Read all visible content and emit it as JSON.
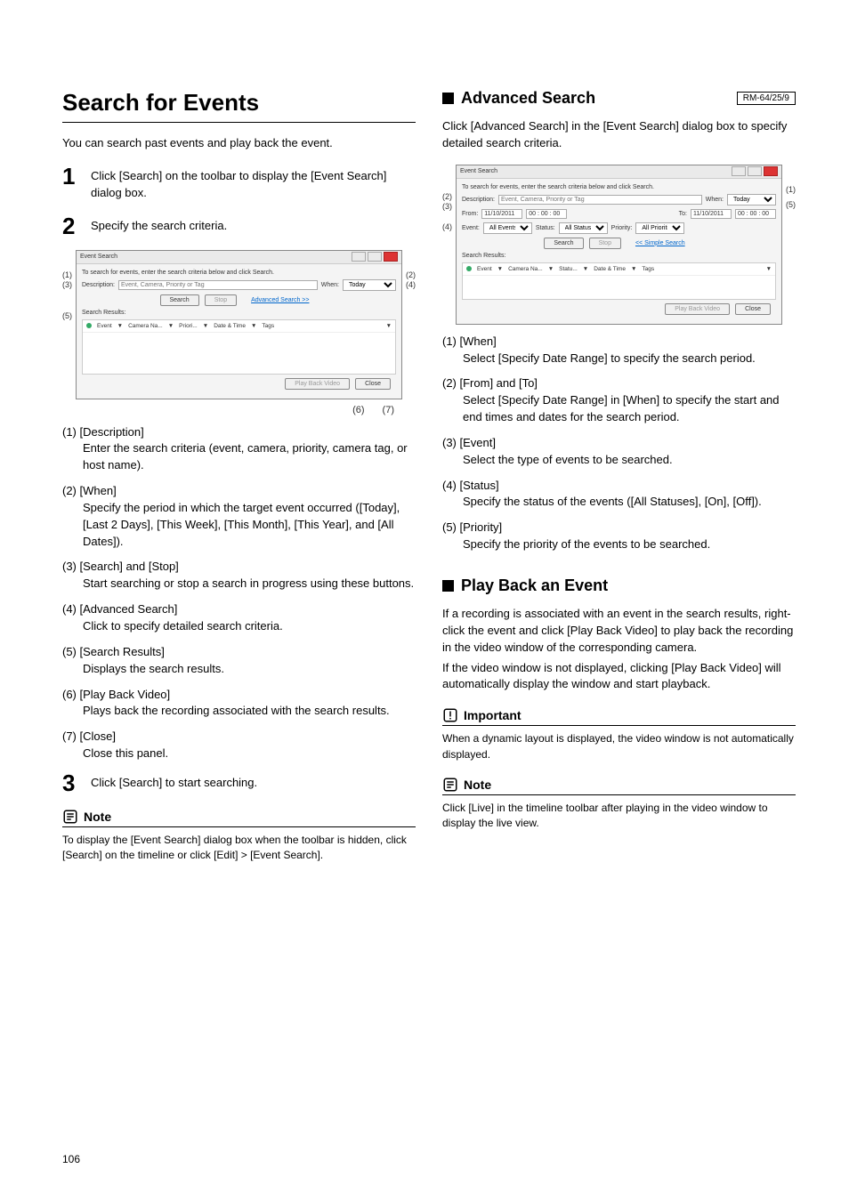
{
  "pageNumber": "106",
  "left": {
    "title": "Search for Events",
    "intro": "You can search past events and play back the event.",
    "steps": {
      "s1": {
        "num": "1",
        "text": "Click [Search] on the toolbar to display the [Event Search] dialog box."
      },
      "s2": {
        "num": "2",
        "text": "Specify the search criteria."
      },
      "s3": {
        "num": "3",
        "text": "Click [Search] to start searching."
      }
    },
    "dialog1": {
      "title": "Event Search",
      "prompt": "To search for events, enter the search criteria below and click Search.",
      "descriptionLabel": "Description:",
      "descriptionPlaceholder": "Event, Camera, Priority or Tag",
      "whenLabel": "When:",
      "whenValue": "Today",
      "searchBtn": "Search",
      "stopBtn": "Stop",
      "advBtn": "Advanced Search >>",
      "resultsLabel": "Search Results:",
      "col_event": "Event",
      "col_camera": "Camera Na...",
      "col_prior": "Priori...",
      "col_date": "Date & Time",
      "col_tags": "Tags",
      "playBackBtn": "Play Back Video",
      "closeBtn": "Close"
    },
    "callouts": {
      "c1": "(1)",
      "c2": "(2)",
      "c3": "(3)",
      "c4": "(4)",
      "c5": "(5)",
      "c6": "(6)",
      "c7": "(7)"
    },
    "items": {
      "i1": {
        "label": "(1) [Description]",
        "desc": "Enter the search criteria (event, camera, priority, camera tag, or host name)."
      },
      "i2": {
        "label": "(2) [When]",
        "desc": "Specify the period in which the target event occurred ([Today], [Last 2 Days], [This Week], [This Month], [This Year], and [All Dates])."
      },
      "i3": {
        "label": "(3) [Search] and [Stop]",
        "desc": "Start searching or stop a search in progress using these buttons."
      },
      "i4": {
        "label": "(4) [Advanced Search]",
        "desc": "Click to specify detailed search criteria."
      },
      "i5": {
        "label": "(5) [Search Results]",
        "desc": "Displays the search results."
      },
      "i6": {
        "label": "(6) [Play Back Video]",
        "desc": "Plays back the recording associated with the search results."
      },
      "i7": {
        "label": "(7) [Close]",
        "desc": "Close this panel."
      }
    },
    "note": {
      "heading": "Note",
      "text": "To display the [Event Search] dialog box when the toolbar is hidden, click [Search] on the timeline or click [Edit] > [Event Search]."
    }
  },
  "right": {
    "advanced": {
      "title": "Advanced Search",
      "tag": "RM-64/25/9",
      "intro": "Click [Advanced Search] in the [Event Search] dialog box to specify detailed search criteria."
    },
    "dialog2": {
      "title": "Event Search",
      "prompt": "To search for events, enter the search criteria below and click Search.",
      "descriptionLabel": "Description:",
      "descriptionPlaceholder": "Event, Camera, Priority or Tag",
      "whenLabel": "When:",
      "whenValue": "Today",
      "fromLabel": "From:",
      "fromDate": "11/10/2011",
      "fromTime": "00 : 00 : 00",
      "toLabel": "To:",
      "toDate": "11/10/2011",
      "toTime": "00 : 00 : 00",
      "eventLabel": "Event:",
      "eventValue": "All Events",
      "statusLabel": "Status:",
      "statusValue": "All Statuses",
      "priorityLabel": "Priority:",
      "priorityValue": "All Priorities",
      "searchBtn": "Search",
      "stopBtn": "Stop",
      "simpleBtn": "<< Simple Search",
      "resultsLabel": "Search Results:",
      "col_event": "Event",
      "col_camera": "Camera Na...",
      "col_status": "Statu...",
      "col_date": "Date & Time",
      "col_tags": "Tags",
      "playBackBtn": "Play Back Video",
      "closeBtn": "Close"
    },
    "callouts": {
      "c1": "(1)",
      "c2": "(2)",
      "c3": "(3)",
      "c4": "(4)",
      "c5": "(5)"
    },
    "items": {
      "i1": {
        "label": "(1) [When]",
        "desc": "Select [Specify Date Range] to specify the search period."
      },
      "i2": {
        "label": "(2) [From] and [To]",
        "desc": "Select [Specify Date Range] in [When] to specify the start and end times and dates for the search period."
      },
      "i3": {
        "label": "(3) [Event]",
        "desc": "Select the type of events to be searched."
      },
      "i4": {
        "label": "(4) [Status]",
        "desc": "Specify the status of the events ([All Statuses], [On], [Off])."
      },
      "i5": {
        "label": "(5) [Priority]",
        "desc": "Specify the priority of the events to be searched."
      }
    },
    "playback": {
      "title": "Play Back an Event",
      "text1": "If a recording is associated with an event in the search results, right-click the event and click [Play Back Video] to play back the recording in the video window of the corresponding camera.",
      "text2": "If the video window is not displayed, clicking [Play Back Video] will automatically display the window and start playback."
    },
    "important": {
      "heading": "Important",
      "text": "When a dynamic layout is displayed, the video window is not automatically displayed."
    },
    "note": {
      "heading": "Note",
      "text": "Click [Live] in the timeline toolbar after playing in the video window to display the live view."
    }
  }
}
